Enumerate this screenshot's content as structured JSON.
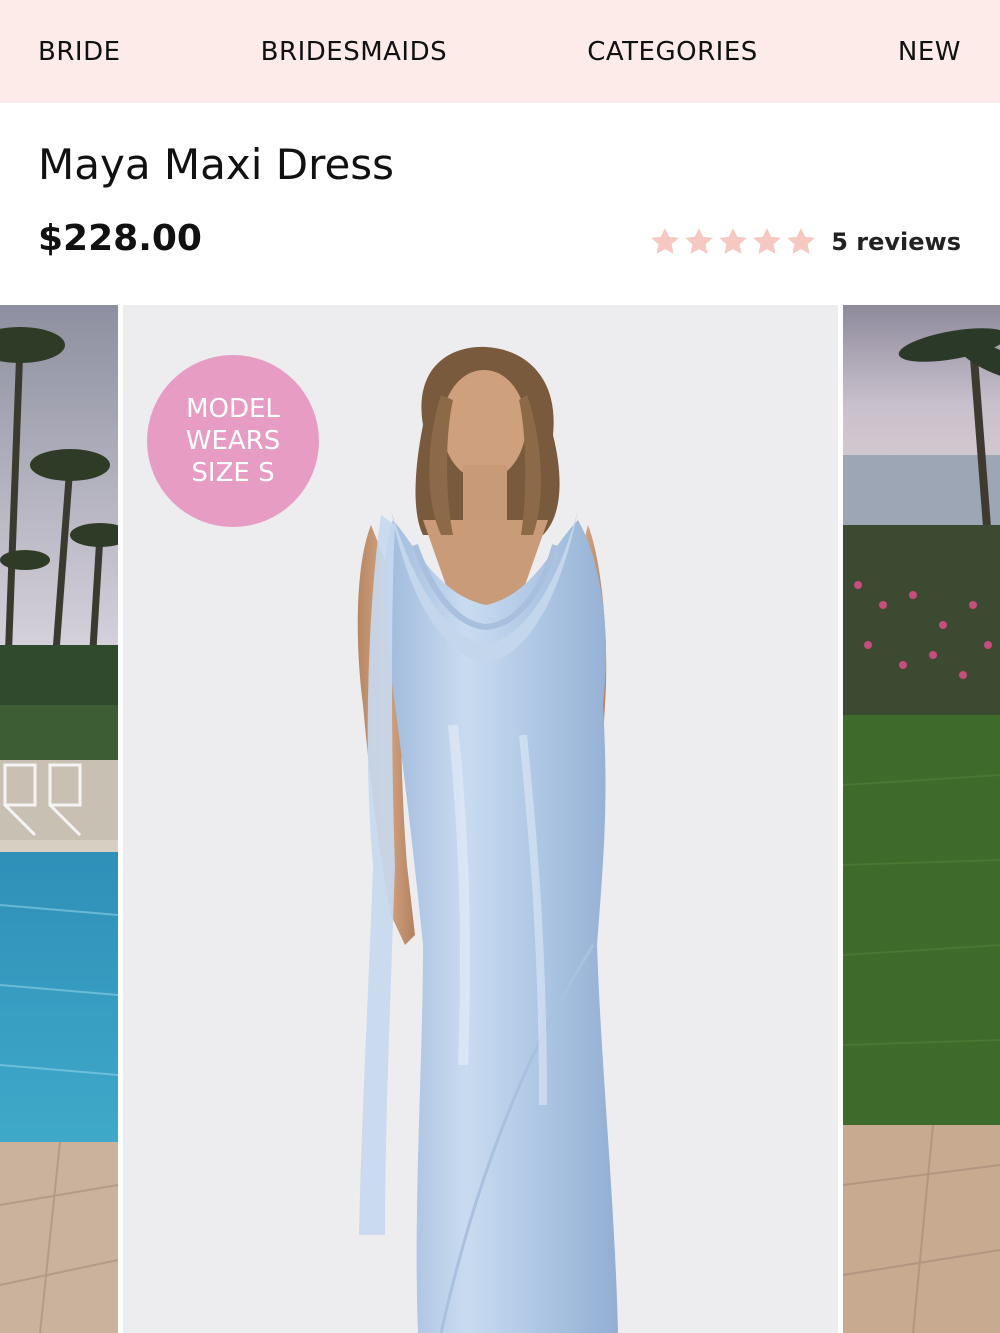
{
  "nav": {
    "items": [
      {
        "label": "BRIDE"
      },
      {
        "label": "BRIDESMAIDS"
      },
      {
        "label": "CATEGORIES"
      },
      {
        "label": "NEW"
      }
    ]
  },
  "product": {
    "title": "Maya Maxi Dress",
    "price": "$228.00",
    "rating": 5,
    "reviews_label": "5 reviews"
  },
  "badge": {
    "line1": "MODEL",
    "line2": "WEARS",
    "line3": "SIZE S"
  },
  "colors": {
    "nav_bg": "#fcebe9",
    "star": "#f6c8c2",
    "badge": "#e79cc4",
    "dress": "#b9d0ea"
  },
  "gallery": {
    "images": [
      {
        "icon": "resort-pool-photo"
      },
      {
        "icon": "model-blue-satin-dress-photo"
      },
      {
        "icon": "garden-lawn-photo"
      }
    ]
  }
}
